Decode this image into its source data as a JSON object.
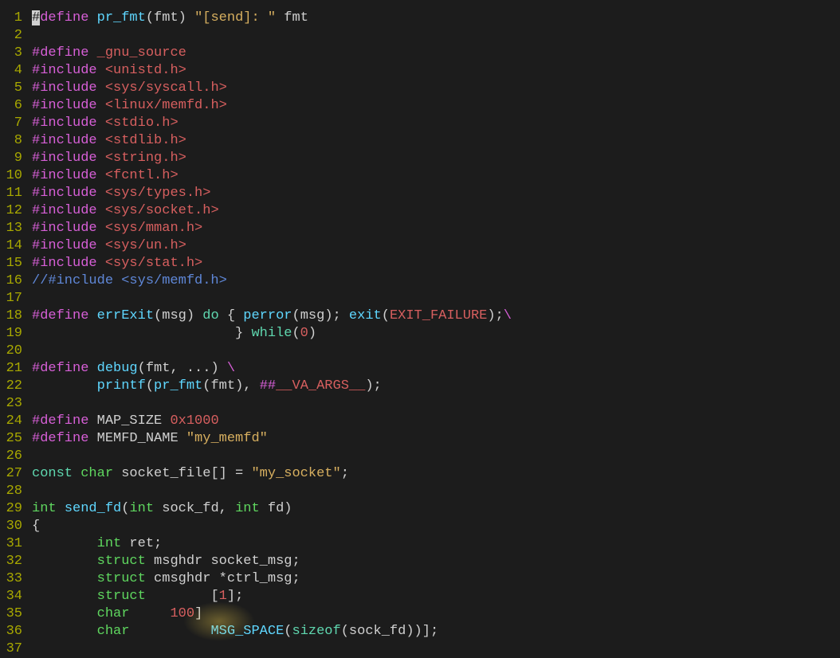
{
  "lines": [
    {
      "n": "1",
      "tokens": [
        {
          "c": "cursor",
          "t": "#"
        },
        {
          "c": "preproc",
          "t": "define "
        },
        {
          "c": "func",
          "t": "pr_fmt"
        },
        {
          "c": "punct",
          "t": "("
        },
        {
          "c": "ident",
          "t": "fmt"
        },
        {
          "c": "punct",
          "t": ") "
        },
        {
          "c": "string",
          "t": "\"[send]: \""
        },
        {
          "c": "punct",
          "t": " fmt"
        }
      ]
    },
    {
      "n": "2",
      "tokens": []
    },
    {
      "n": "3",
      "tokens": [
        {
          "c": "preproc",
          "t": "#define "
        },
        {
          "c": "number",
          "t": "_gnu_source"
        }
      ]
    },
    {
      "n": "4",
      "tokens": [
        {
          "c": "preproc",
          "t": "#include "
        },
        {
          "c": "header",
          "t": "<unistd.h>"
        }
      ]
    },
    {
      "n": "5",
      "tokens": [
        {
          "c": "preproc",
          "t": "#include "
        },
        {
          "c": "header",
          "t": "<sys/syscall.h>"
        }
      ]
    },
    {
      "n": "6",
      "tokens": [
        {
          "c": "preproc",
          "t": "#include "
        },
        {
          "c": "header",
          "t": "<linux/memfd.h>"
        }
      ]
    },
    {
      "n": "7",
      "tokens": [
        {
          "c": "preproc",
          "t": "#include "
        },
        {
          "c": "header",
          "t": "<stdio.h>"
        }
      ]
    },
    {
      "n": "8",
      "tokens": [
        {
          "c": "preproc",
          "t": "#include "
        },
        {
          "c": "header",
          "t": "<stdlib.h>"
        }
      ]
    },
    {
      "n": "9",
      "tokens": [
        {
          "c": "preproc",
          "t": "#include "
        },
        {
          "c": "header",
          "t": "<string.h>"
        }
      ]
    },
    {
      "n": "10",
      "tokens": [
        {
          "c": "preproc",
          "t": "#include "
        },
        {
          "c": "header",
          "t": "<fcntl.h>"
        }
      ]
    },
    {
      "n": "11",
      "tokens": [
        {
          "c": "preproc",
          "t": "#include "
        },
        {
          "c": "header",
          "t": "<sys/types.h>"
        }
      ]
    },
    {
      "n": "12",
      "tokens": [
        {
          "c": "preproc",
          "t": "#include "
        },
        {
          "c": "header",
          "t": "<sys/socket.h>"
        }
      ]
    },
    {
      "n": "13",
      "tokens": [
        {
          "c": "preproc",
          "t": "#include "
        },
        {
          "c": "header",
          "t": "<sys/mman.h>"
        }
      ]
    },
    {
      "n": "14",
      "tokens": [
        {
          "c": "preproc",
          "t": "#include "
        },
        {
          "c": "header",
          "t": "<sys/un.h>"
        }
      ]
    },
    {
      "n": "15",
      "tokens": [
        {
          "c": "preproc",
          "t": "#include "
        },
        {
          "c": "header",
          "t": "<sys/stat.h>"
        }
      ]
    },
    {
      "n": "16",
      "tokens": [
        {
          "c": "comment",
          "t": "//#include <sys/memfd.h>"
        }
      ]
    },
    {
      "n": "17",
      "tokens": []
    },
    {
      "n": "18",
      "tokens": [
        {
          "c": "preproc",
          "t": "#define "
        },
        {
          "c": "func",
          "t": "errExit"
        },
        {
          "c": "punct",
          "t": "("
        },
        {
          "c": "ident",
          "t": "msg"
        },
        {
          "c": "punct",
          "t": ") "
        },
        {
          "c": "keyword",
          "t": "do"
        },
        {
          "c": "punct",
          "t": " { "
        },
        {
          "c": "func",
          "t": "perror"
        },
        {
          "c": "punct",
          "t": "("
        },
        {
          "c": "ident",
          "t": "msg"
        },
        {
          "c": "punct",
          "t": "); "
        },
        {
          "c": "func",
          "t": "exit"
        },
        {
          "c": "punct",
          "t": "("
        },
        {
          "c": "number",
          "t": "EXIT_FAILURE"
        },
        {
          "c": "punct",
          "t": ");"
        },
        {
          "c": "preproc",
          "t": "\\"
        }
      ]
    },
    {
      "n": "19",
      "tokens": [
        {
          "c": "ident",
          "t": "                         "
        },
        {
          "c": "punct",
          "t": "} "
        },
        {
          "c": "keyword",
          "t": "while"
        },
        {
          "c": "punct",
          "t": "("
        },
        {
          "c": "number",
          "t": "0"
        },
        {
          "c": "punct",
          "t": ")"
        }
      ]
    },
    {
      "n": "20",
      "tokens": []
    },
    {
      "n": "21",
      "tokens": [
        {
          "c": "preproc",
          "t": "#define "
        },
        {
          "c": "func",
          "t": "debug"
        },
        {
          "c": "punct",
          "t": "("
        },
        {
          "c": "ident",
          "t": "fmt"
        },
        {
          "c": "punct",
          "t": ", ...) "
        },
        {
          "c": "preproc",
          "t": "\\"
        }
      ]
    },
    {
      "n": "22",
      "tokens": [
        {
          "c": "ident",
          "t": "        "
        },
        {
          "c": "func",
          "t": "printf"
        },
        {
          "c": "punct",
          "t": "("
        },
        {
          "c": "func",
          "t": "pr_fmt"
        },
        {
          "c": "punct",
          "t": "("
        },
        {
          "c": "ident",
          "t": "fmt"
        },
        {
          "c": "punct",
          "t": "), "
        },
        {
          "c": "preproc",
          "t": "##"
        },
        {
          "c": "number",
          "t": "__VA_ARGS__"
        },
        {
          "c": "punct",
          "t": ");"
        }
      ]
    },
    {
      "n": "23",
      "tokens": []
    },
    {
      "n": "24",
      "tokens": [
        {
          "c": "preproc",
          "t": "#define "
        },
        {
          "c": "ident",
          "t": "MAP_SIZE "
        },
        {
          "c": "number",
          "t": "0x1000"
        }
      ]
    },
    {
      "n": "25",
      "tokens": [
        {
          "c": "preproc",
          "t": "#define "
        },
        {
          "c": "ident",
          "t": "MEMFD_NAME "
        },
        {
          "c": "string",
          "t": "\"my_memfd\""
        }
      ]
    },
    {
      "n": "26",
      "tokens": []
    },
    {
      "n": "27",
      "tokens": [
        {
          "c": "keyword",
          "t": "const "
        },
        {
          "c": "type",
          "t": "char"
        },
        {
          "c": "ident",
          "t": " socket_file"
        },
        {
          "c": "punct",
          "t": "[] = "
        },
        {
          "c": "string",
          "t": "\"my_socket\""
        },
        {
          "c": "punct",
          "t": ";"
        }
      ]
    },
    {
      "n": "28",
      "tokens": []
    },
    {
      "n": "29",
      "tokens": [
        {
          "c": "type",
          "t": "int"
        },
        {
          "c": "ident",
          "t": " "
        },
        {
          "c": "func",
          "t": "send_fd"
        },
        {
          "c": "punct",
          "t": "("
        },
        {
          "c": "type",
          "t": "int"
        },
        {
          "c": "ident",
          "t": " sock_fd"
        },
        {
          "c": "punct",
          "t": ", "
        },
        {
          "c": "type",
          "t": "int"
        },
        {
          "c": "ident",
          "t": " fd"
        },
        {
          "c": "punct",
          "t": ")"
        }
      ]
    },
    {
      "n": "30",
      "tokens": [
        {
          "c": "punct",
          "t": "{"
        }
      ]
    },
    {
      "n": "31",
      "tokens": [
        {
          "c": "ident",
          "t": "        "
        },
        {
          "c": "type",
          "t": "int"
        },
        {
          "c": "ident",
          "t": " ret"
        },
        {
          "c": "punct",
          "t": ";"
        }
      ]
    },
    {
      "n": "32",
      "tokens": [
        {
          "c": "ident",
          "t": "        "
        },
        {
          "c": "type",
          "t": "struct"
        },
        {
          "c": "ident",
          "t": " msghdr socket_msg"
        },
        {
          "c": "punct",
          "t": ";"
        }
      ]
    },
    {
      "n": "33",
      "tokens": [
        {
          "c": "ident",
          "t": "        "
        },
        {
          "c": "type",
          "t": "struct"
        },
        {
          "c": "ident",
          "t": " cmsghdr "
        },
        {
          "c": "punct",
          "t": "*"
        },
        {
          "c": "ident",
          "t": "ctrl_msg"
        },
        {
          "c": "punct",
          "t": ";"
        }
      ]
    },
    {
      "n": "34",
      "tokens": [
        {
          "c": "ident",
          "t": "        "
        },
        {
          "c": "type",
          "t": "struct"
        },
        {
          "c": "ident",
          "t": "        "
        },
        {
          "c": "punct",
          "t": "["
        },
        {
          "c": "number",
          "t": "1"
        },
        {
          "c": "punct",
          "t": "];"
        }
      ]
    },
    {
      "n": "35",
      "tokens": [
        {
          "c": "ident",
          "t": "        "
        },
        {
          "c": "type",
          "t": "char"
        },
        {
          "c": "ident",
          "t": "     "
        },
        {
          "c": "number",
          "t": "100"
        },
        {
          "c": "punct",
          "t": "]"
        }
      ],
      "glow": true
    },
    {
      "n": "36",
      "tokens": [
        {
          "c": "ident",
          "t": "        "
        },
        {
          "c": "type",
          "t": "char"
        },
        {
          "c": "ident",
          "t": "          "
        },
        {
          "c": "func",
          "t": "MSG_SPACE"
        },
        {
          "c": "punct",
          "t": "("
        },
        {
          "c": "keyword",
          "t": "sizeof"
        },
        {
          "c": "punct",
          "t": "("
        },
        {
          "c": "ident",
          "t": "sock_fd"
        },
        {
          "c": "punct",
          "t": "))];"
        }
      ]
    },
    {
      "n": "37",
      "tokens": []
    }
  ]
}
